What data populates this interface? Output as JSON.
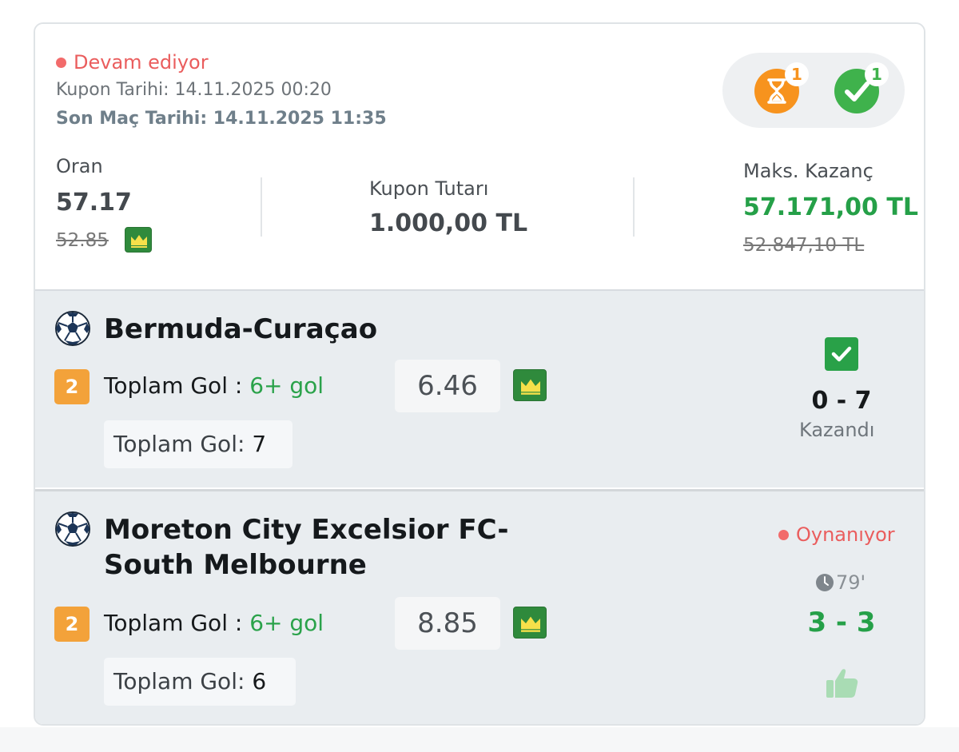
{
  "coupon": {
    "status": "Devam ediyor",
    "coupon_date": "Kupon Tarihi: 14.11.2025 00:20",
    "last_match_date": "Son Maç Tarihi: 14.11.2025 11:35",
    "pending_count": "1",
    "won_count": "1",
    "odds_label": "Oran",
    "odds_value": "57.17",
    "odds_old": "52.85",
    "amount_label": "Kupon Tutarı",
    "amount_value": "1.000,00 TL",
    "max_label": "Maks. Kazanç",
    "max_value": "57.171,00 TL",
    "max_old": "52.847,10 TL"
  },
  "matches": [
    {
      "teams": "Bermuda-Curaçao",
      "bet_number": "2",
      "bet_market": "Toplam Gol : ",
      "bet_pick": "6+ gol",
      "odd": "6.46",
      "total_label": "Toplam Gol: ",
      "total_value": "7",
      "score": "0 - 7",
      "result": "Kazandı"
    },
    {
      "teams_line1": "Moreton City Excelsior FC-",
      "teams_line2": "South Melbourne",
      "bet_number": "2",
      "bet_market": "Toplam Gol : ",
      "bet_pick": "6+ gol",
      "odd": "8.85",
      "total_label": "Toplam Gol: ",
      "total_value": "6",
      "live_status": "Oynanıyor",
      "minute": "79'",
      "score": "3 - 3"
    }
  ],
  "colors": {
    "live_red": "#ea5d5d",
    "win_green": "#29a148",
    "pending_orange": "#f7931e",
    "number_orange": "#f3a23a"
  },
  "icons": [
    "hourglass-icon",
    "check-circle-icon",
    "crown-icon",
    "soccer-ball-icon",
    "check-square-icon",
    "clock-icon",
    "thumbs-up-icon"
  ]
}
